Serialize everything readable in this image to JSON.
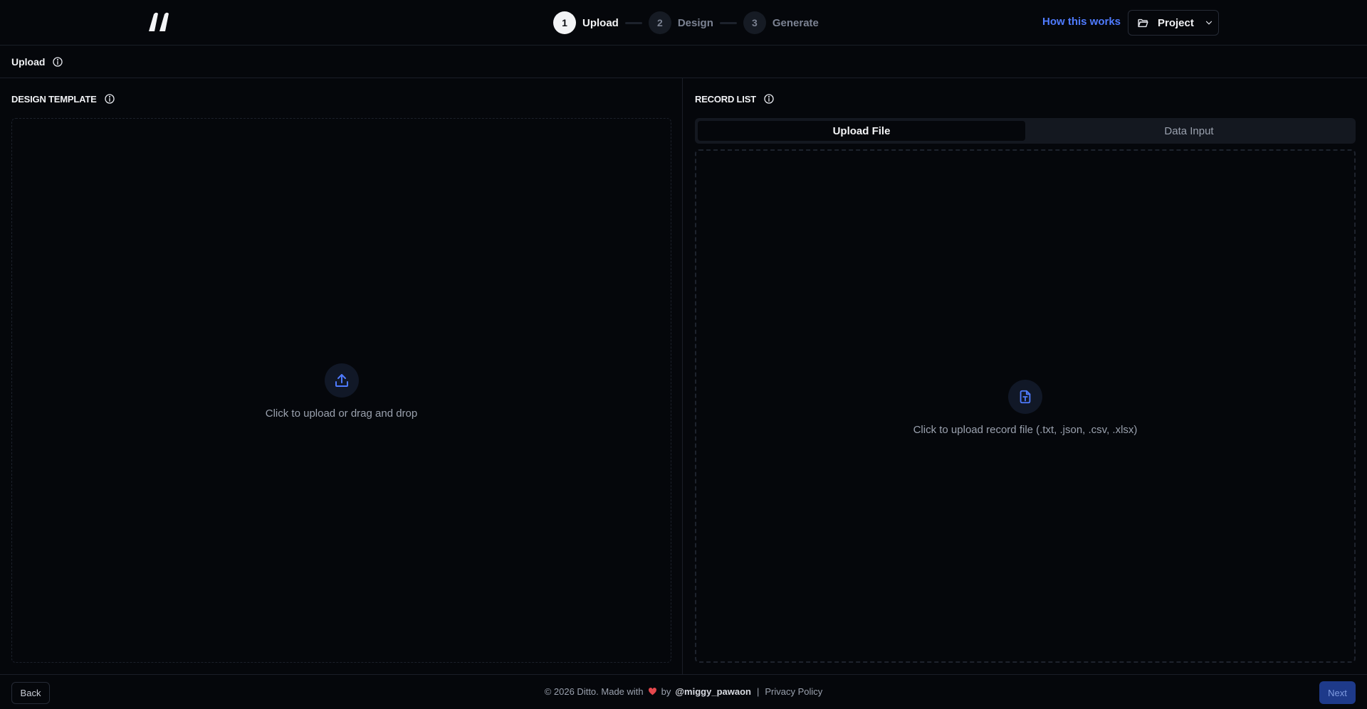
{
  "header": {
    "steps": [
      {
        "num": "1",
        "label": "Upload"
      },
      {
        "num": "2",
        "label": "Design"
      },
      {
        "num": "3",
        "label": "Generate"
      }
    ],
    "active_step": 1,
    "how_link": "How this works",
    "project_label": "Project"
  },
  "subheader": {
    "title": "Upload"
  },
  "left_panel": {
    "title": "DESIGN TEMPLATE",
    "dropzone_text": "Click to upload or drag and drop"
  },
  "right_panel": {
    "title": "RECORD LIST",
    "tabs": [
      "Upload File",
      "Data Input"
    ],
    "active_tab": 0,
    "dropzone_text": "Click to upload record file (.txt, .json, .csv, .xlsx)"
  },
  "footer": {
    "back_label": "Back",
    "copyright": "© 2026 Ditto. Made with",
    "by": "by",
    "author": "@miggy_pawaon",
    "separator": "|",
    "privacy": "Privacy Policy",
    "next_label": "Next"
  },
  "colors": {
    "background": "#05070b",
    "accent": "#4f7bff",
    "heart": "#e5484d",
    "next_button": "#1e3a8a"
  },
  "icons": [
    "logo-quote-icon",
    "folder-icon",
    "chevron-down-icon",
    "info-icon",
    "upload-icon",
    "file-text-icon",
    "heart-icon"
  ]
}
